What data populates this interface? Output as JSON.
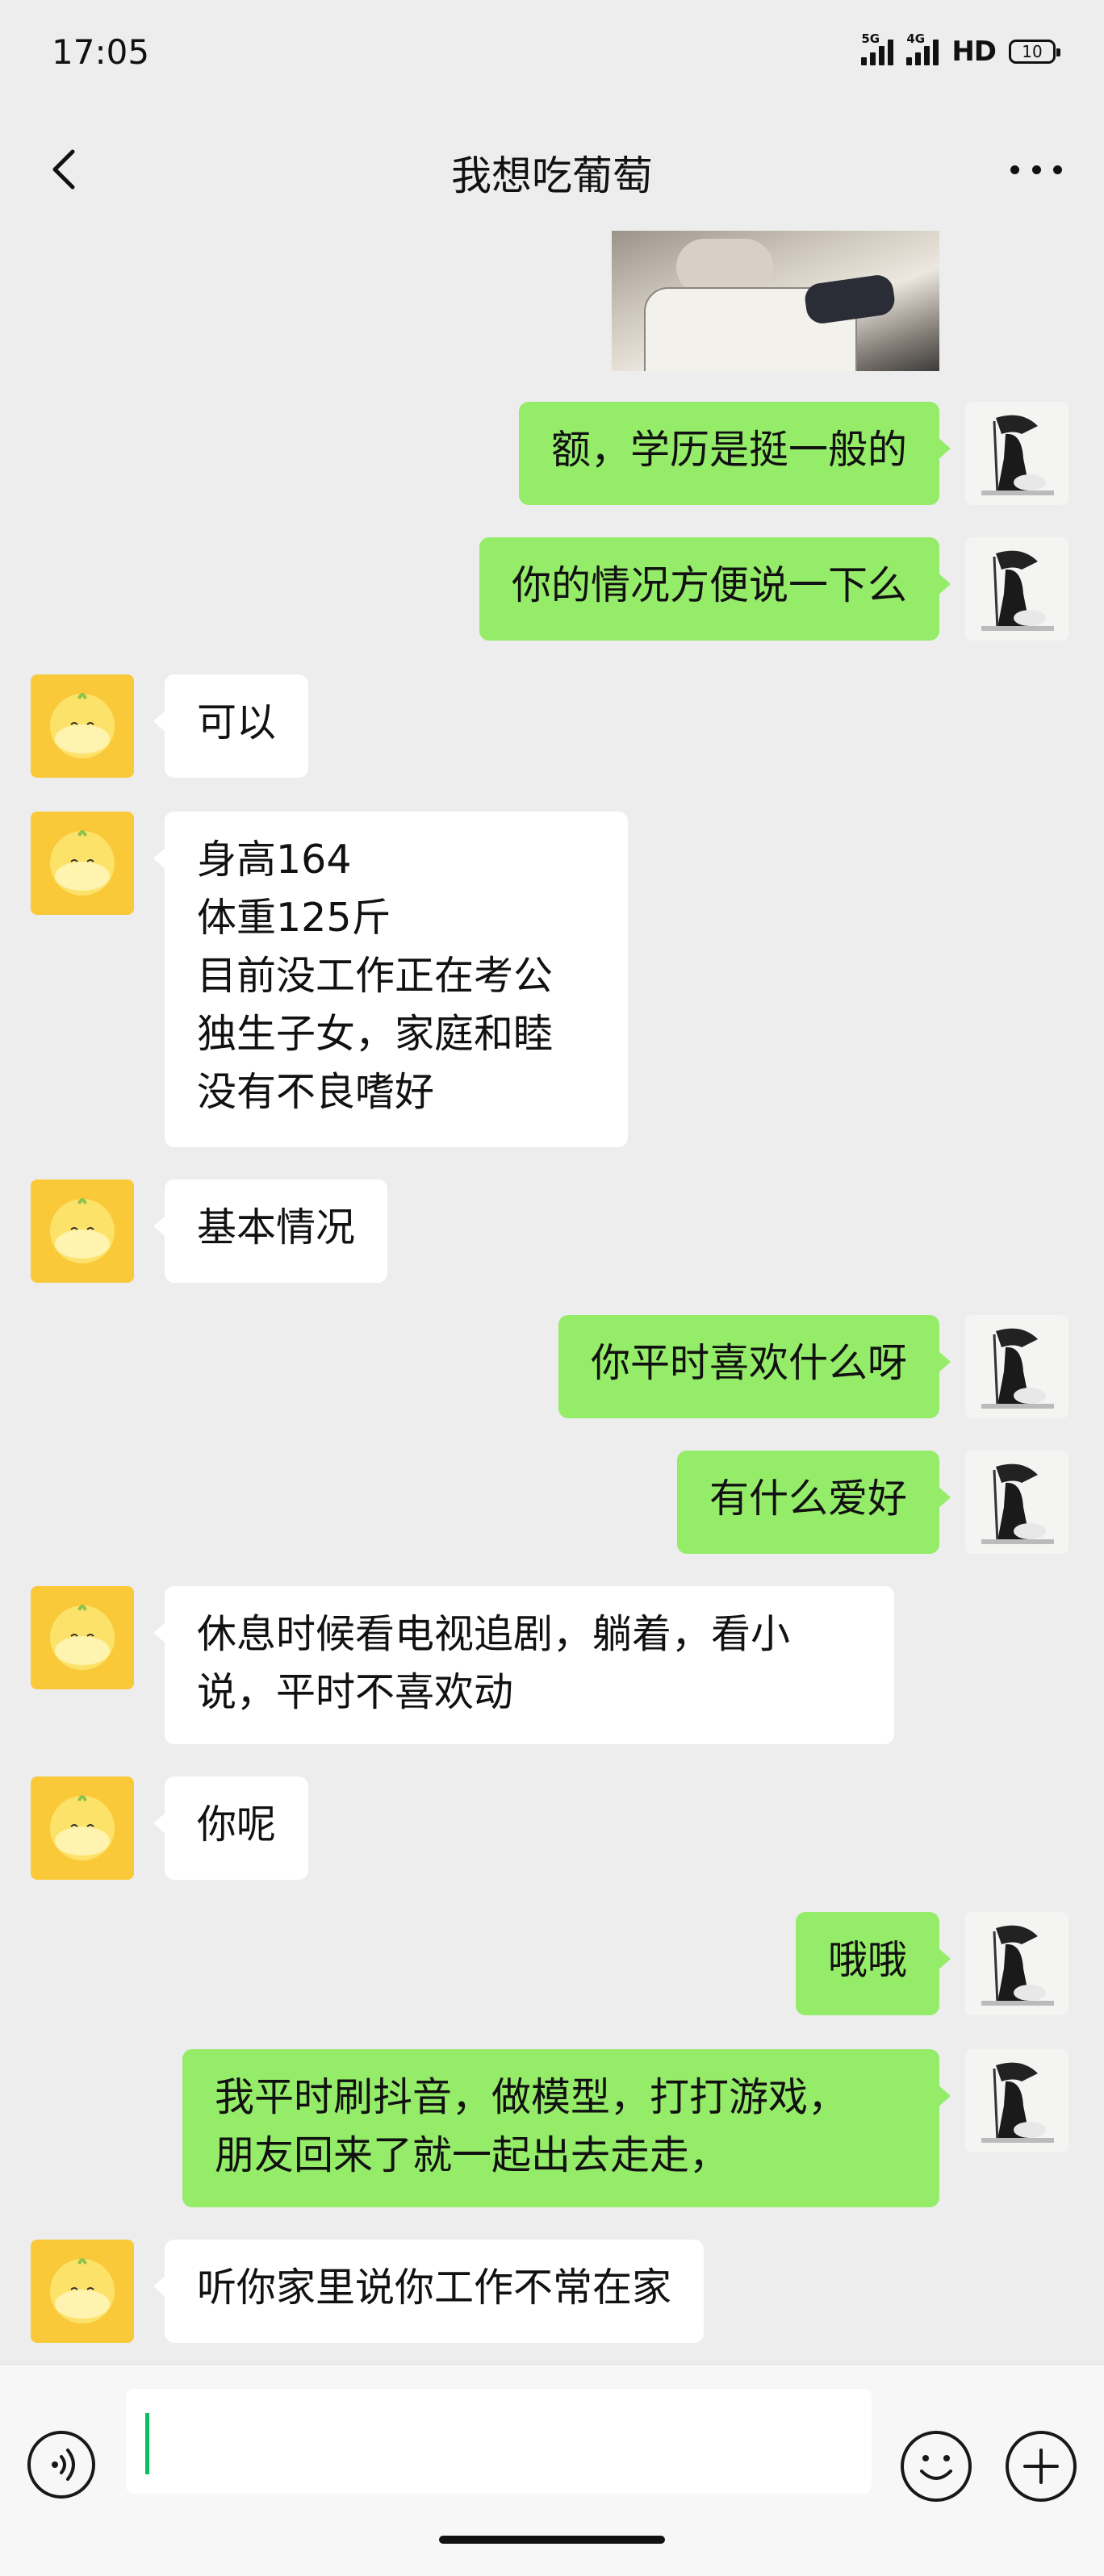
{
  "status_bar": {
    "time": "17:05",
    "network_1": "5G",
    "network_2": "4G",
    "hd_label": "HD",
    "battery": "10"
  },
  "header": {
    "title": "我想吃葡萄",
    "back_icon": "chevron-left-icon",
    "more_icon": "more-horizontal-icon"
  },
  "messages": [
    {
      "sender": "me",
      "type": "image"
    },
    {
      "sender": "me",
      "text": "额，学历是挺一般的"
    },
    {
      "sender": "me",
      "text": "你的情况方便说一下么"
    },
    {
      "sender": "them",
      "text": "可以"
    },
    {
      "sender": "them",
      "text": "身高164\n体重125斤\n目前没工作正在考公\n独生子女，家庭和睦\n没有不良嗜好"
    },
    {
      "sender": "them",
      "text": "基本情况"
    },
    {
      "sender": "me",
      "text": "你平时喜欢什么呀"
    },
    {
      "sender": "me",
      "text": "有什么爱好"
    },
    {
      "sender": "them",
      "text": "休息时候看电视追剧，躺着，看小\n说，平时不喜欢动"
    },
    {
      "sender": "them",
      "text": "你呢"
    },
    {
      "sender": "me",
      "text": "哦哦"
    },
    {
      "sender": "me",
      "text": "我平时刷抖音，做模型，打打游戏，\n朋友回来了就一起出去走走，"
    },
    {
      "sender": "them",
      "text": "听你家里说你工作不常在家"
    }
  ],
  "input_bar": {
    "value": "",
    "voice_icon": "voice-icon",
    "emoji_icon": "emoji-icon",
    "plus_icon": "plus-circle-icon"
  },
  "colors": {
    "background": "#ededed",
    "my_bubble": "#95ec69",
    "their_bubble": "#ffffff",
    "cursor": "#07c160"
  }
}
